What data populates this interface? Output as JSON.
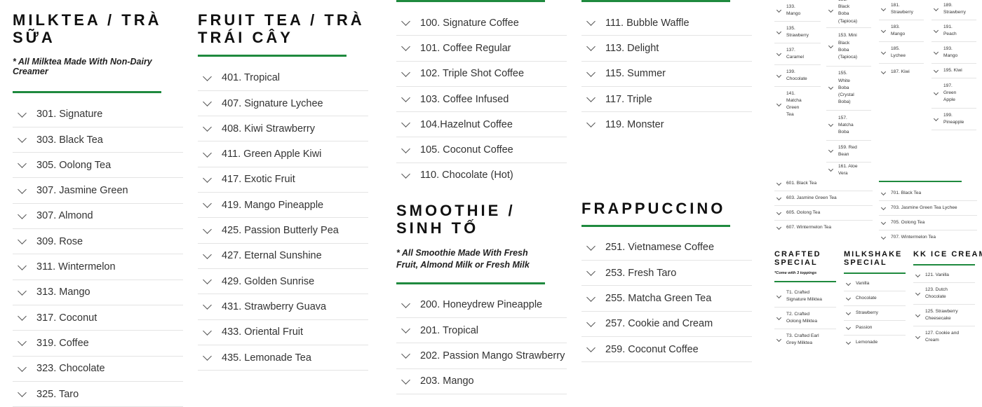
{
  "milktea": {
    "title": "MILKTEA / TRÀ SỮA",
    "subtitle": "* All Milktea Made With Non-Dairy Creamer",
    "items": [
      "301. Signature",
      "303. Black Tea",
      "305. Oolong Tea",
      "307. Jasmine Green",
      "307. Almond",
      "309. Rose",
      "311. Wintermelon",
      "313. Mango",
      "317. Coconut",
      "319. Coffee",
      "323. Chocolate",
      "325. Taro"
    ]
  },
  "fruit_tea": {
    "title": "FRUIT TEA / TRÀ TRÁI CÂY",
    "items": [
      "401. Tropical",
      "407. Signature Lychee",
      "408. Kiwi Strawberry",
      "411. Green Apple Kiwi",
      "417. Exotic Fruit",
      "419. Mango Pineapple",
      "425. Passion Butterly Pea",
      "427. Eternal Sunshine",
      "429. Golden Sunrise",
      "431. Strawberry Guava",
      "433. Oriental Fruit",
      "435. Lemonade Tea"
    ]
  },
  "coffee": {
    "items": [
      "100. Signature Coffee",
      "101. Coffee Regular",
      "102. Triple Shot Coffee",
      "103. Coffee Infused",
      "104.Hazelnut Coffee",
      "105. Coconut Coffee",
      "110. Chocolate (Hot)"
    ]
  },
  "smoothie": {
    "title": "SMOOTHIE / SINH TỐ",
    "subtitle": "* All Smoothie Made With Fresh Fruit, Almond Milk or Fresh Milk",
    "items": [
      "200. Honeydrew Pineapple",
      "201. Tropical",
      "202. Passion Mango Strawberry",
      "203. Mango"
    ]
  },
  "waffle": {
    "items": [
      "111. Bubble Waffle",
      "113. Delight",
      "115. Summer",
      "117. Triple",
      "119. Monster"
    ]
  },
  "frappuccino": {
    "title": "FRAPPUCCINO",
    "items": [
      "251. Vietnamese Coffee",
      "253. Fresh Taro",
      "255. Matcha Green Tea",
      "257. Cookie and Cream",
      "259. Coconut Coffee"
    ]
  },
  "small_a": {
    "items": [
      "133. Mango",
      "135. Strawberry",
      "137. Caramel",
      "139. Chocolate",
      "141. Matcha Green Tea"
    ]
  },
  "small_b": {
    "items": [
      "151. Black Boba (Tapioca)",
      "153. Mini Black Boba (Tapioca)",
      "155. White Boba (Crystal Boba)",
      "157. Matcha Boba",
      "159. Red Bean",
      "161. Aloe Vera"
    ]
  },
  "small_c": {
    "items": [
      "181. Strawberry",
      "183. Mango",
      "185. Lychee",
      "187. Kiwi"
    ]
  },
  "small_d": {
    "items": [
      "189. Strawberry",
      "191. Peach",
      "193. Mango",
      "195. Kiwi",
      "197. Green Apple",
      "199. Pineapple"
    ]
  },
  "small_tea_a": {
    "items": [
      "601. Black Tea",
      "603. Jasmine Green Tea",
      "605. Oolong Tea",
      "607. Wintermelon Tea"
    ]
  },
  "small_tea_b": {
    "items": [
      "701. Black Tea",
      "703. Jasmine Green Tea Lychee",
      "705. Oolong Tea",
      "707. Wintermelon Tea"
    ]
  },
  "crafted": {
    "title": "CRAFTED SPECIAL",
    "note": "*Come with 3 toppings",
    "items": [
      "T1. Crafted Signature Milktea",
      "T2. Crafted Oolong Milktea",
      "T3. Crafted Earl Grey Milktea"
    ]
  },
  "milkshake": {
    "title": "MILKSHAKE SPECIAL",
    "items": [
      "Vanilla",
      "Chocolate",
      "Strawberry",
      "Passion",
      "Lemonade"
    ]
  },
  "kk_ice_cream": {
    "title": "KK ICE CREAM",
    "items": [
      "121. Vanilla",
      "123. Dutch Chocolate",
      "125. Strawberry Cheesecake",
      "127. Cookie and Cream"
    ]
  },
  "colors": {
    "accent": "#1f8a3e",
    "divider": "#e4e4e4",
    "text": "#333333"
  }
}
